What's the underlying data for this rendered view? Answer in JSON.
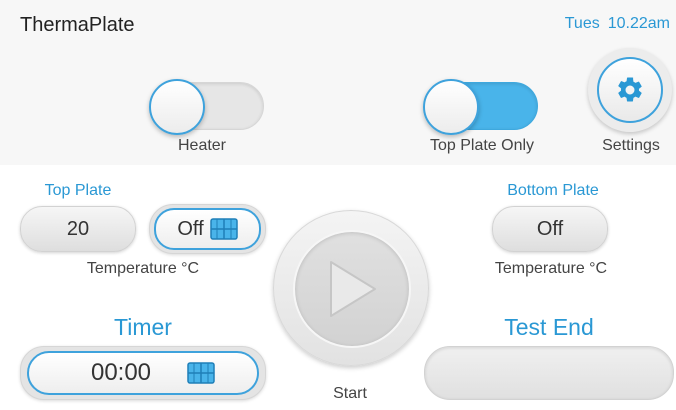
{
  "app": {
    "title": "ThermaPlate"
  },
  "status": {
    "day": "Tues",
    "time": "10.22am"
  },
  "controls": {
    "heater": {
      "label": "Heater",
      "state": "off"
    },
    "top_plate_only": {
      "label": "Top Plate Only",
      "state": "on"
    },
    "settings": {
      "label": "Settings"
    }
  },
  "top_plate": {
    "title": "Top Plate",
    "temperature_value": "20",
    "switch_label": "Off",
    "unit_label": "Temperature °C"
  },
  "bottom_plate": {
    "title": "Bottom Plate",
    "switch_label": "Off",
    "unit_label": "Temperature °C"
  },
  "start": {
    "label": "Start"
  },
  "timer": {
    "title": "Timer",
    "value": "00:00"
  },
  "test_end": {
    "title": "Test End",
    "value": ""
  },
  "colors": {
    "accent": "#2a98d4",
    "toggle_on": "#49b4ea"
  },
  "icons": {
    "settings": "gear-icon",
    "switch": "grid-icon",
    "start": "play-icon"
  }
}
